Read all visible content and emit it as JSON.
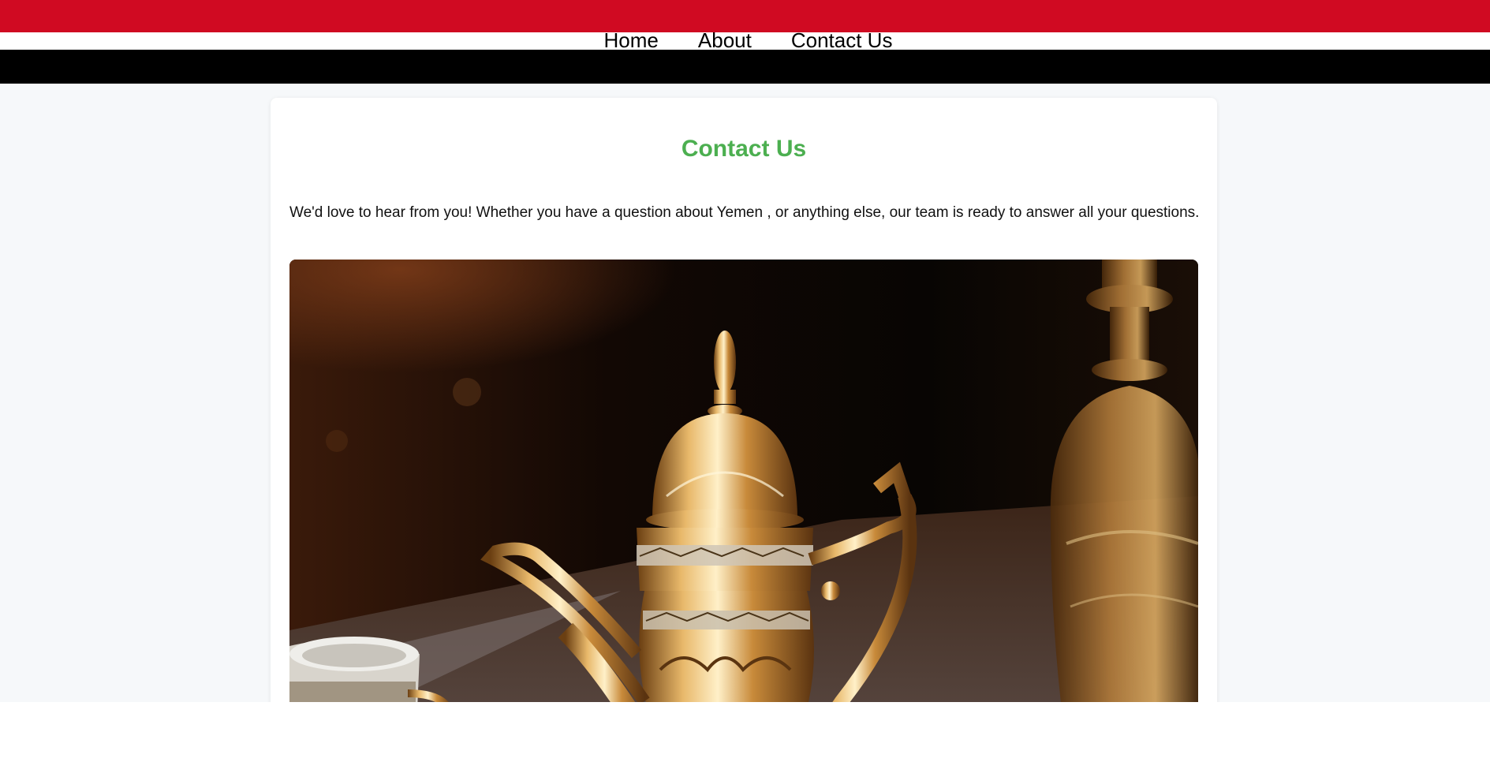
{
  "nav": {
    "items": [
      {
        "label": "Home"
      },
      {
        "label": "About"
      },
      {
        "label": "Contact Us"
      }
    ]
  },
  "contact": {
    "title": "Contact Us",
    "intro": "We'd love to hear from you! Whether you have a question about Yemen , or anything else, our team is ready to answer all your questions."
  },
  "colors": {
    "flag_red": "#d00a22",
    "flag_white": "#ffffff",
    "flag_black": "#000000",
    "title_green": "#4caf50"
  },
  "photo": {
    "subject": "ornate gold coffee pot"
  }
}
